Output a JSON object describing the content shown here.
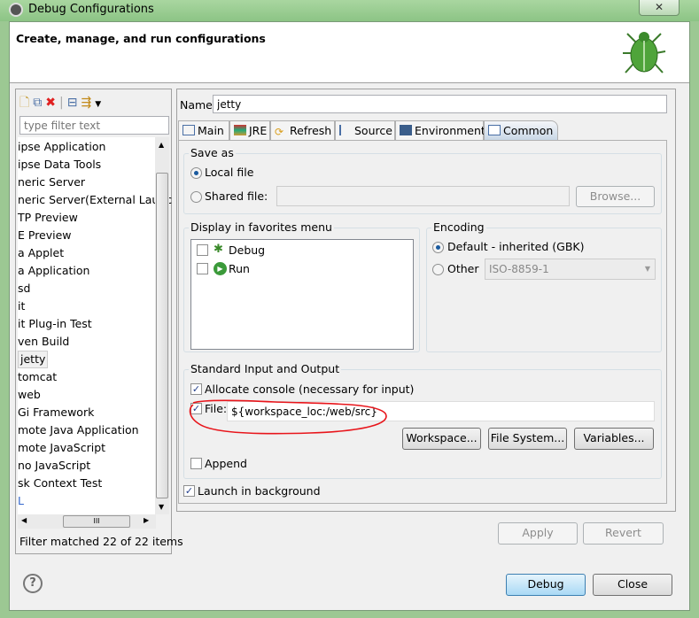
{
  "window": {
    "title": "Debug Configurations",
    "header": "Create, manage, and run configurations"
  },
  "left": {
    "filter_placeholder": "type filter text",
    "items": [
      "ipse Application",
      "ipse Data Tools",
      "neric Server",
      "neric Server(External Launc",
      "TP Preview",
      "E Preview",
      "a Applet",
      "a Application",
      "sd",
      "it",
      "it Plug-in Test",
      "ven Build",
      "jetty",
      "tomcat",
      "web",
      "Gi Framework",
      "mote Java Application",
      "mote JavaScript",
      "no JavaScript",
      "sk Context Test",
      "L"
    ],
    "selected": "jetty",
    "filter_status": "Filter matched 22 of 22 items",
    "hscroll_grip": "III"
  },
  "config": {
    "name_label": "Name:",
    "name_value": "jetty",
    "tabs": [
      "Main",
      "JRE",
      "Refresh",
      "Source",
      "Environment",
      "Common"
    ],
    "active_tab": "Common",
    "save_as": {
      "title": "Save as",
      "local": "Local file",
      "shared": "Shared file:",
      "browse": "Browse..."
    },
    "favorites": {
      "title": "Display in favorites menu",
      "items": [
        "Debug",
        "Run"
      ]
    },
    "encoding": {
      "title": "Encoding",
      "default": "Default - inherited (GBK)",
      "other": "Other",
      "other_value": "ISO-8859-1"
    },
    "stdio": {
      "title": "Standard Input and Output",
      "allocate": "Allocate console (necessary for input)",
      "file_label": "File:",
      "file_value": "${workspace_loc:/web/src}",
      "workspace": "Workspace...",
      "filesystem": "File System...",
      "variables": "Variables...",
      "append": "Append"
    },
    "launch_bg": "Launch in background",
    "apply": "Apply",
    "revert": "Revert"
  },
  "footer": {
    "help": "?",
    "debug": "Debug",
    "close": "Close"
  },
  "colors": {
    "annotation": "#e8151b",
    "accent": "#3c7fb1"
  }
}
